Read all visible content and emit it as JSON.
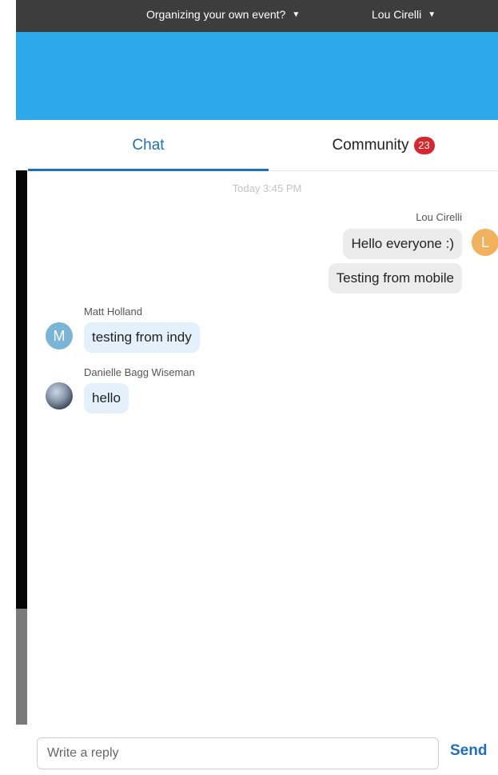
{
  "topbar": {
    "organizing_label": "Organizing your own event?",
    "user_label": "Lou Cirelli"
  },
  "tabs": {
    "chat_label": "Chat",
    "community_label": "Community",
    "community_badge": "23"
  },
  "chat": {
    "timestamp": "Today 3:45 PM",
    "messages": [
      {
        "sender": "Lou Cirelli",
        "avatar_initial": "L",
        "bubbles": [
          "Hello everyone :)",
          "Testing from mobile"
        ]
      },
      {
        "sender": "Matt Holland",
        "avatar_initial": "M",
        "bubbles": [
          "testing from indy"
        ]
      },
      {
        "sender": "Danielle Bagg Wiseman",
        "avatar_initial": "",
        "bubbles": [
          "hello"
        ]
      }
    ]
  },
  "reply": {
    "placeholder": "Write a reply",
    "send_label": "Send"
  },
  "colors": {
    "accent": "#1f6fbf",
    "banner": "#2da8e8",
    "badge": "#d9262b"
  }
}
